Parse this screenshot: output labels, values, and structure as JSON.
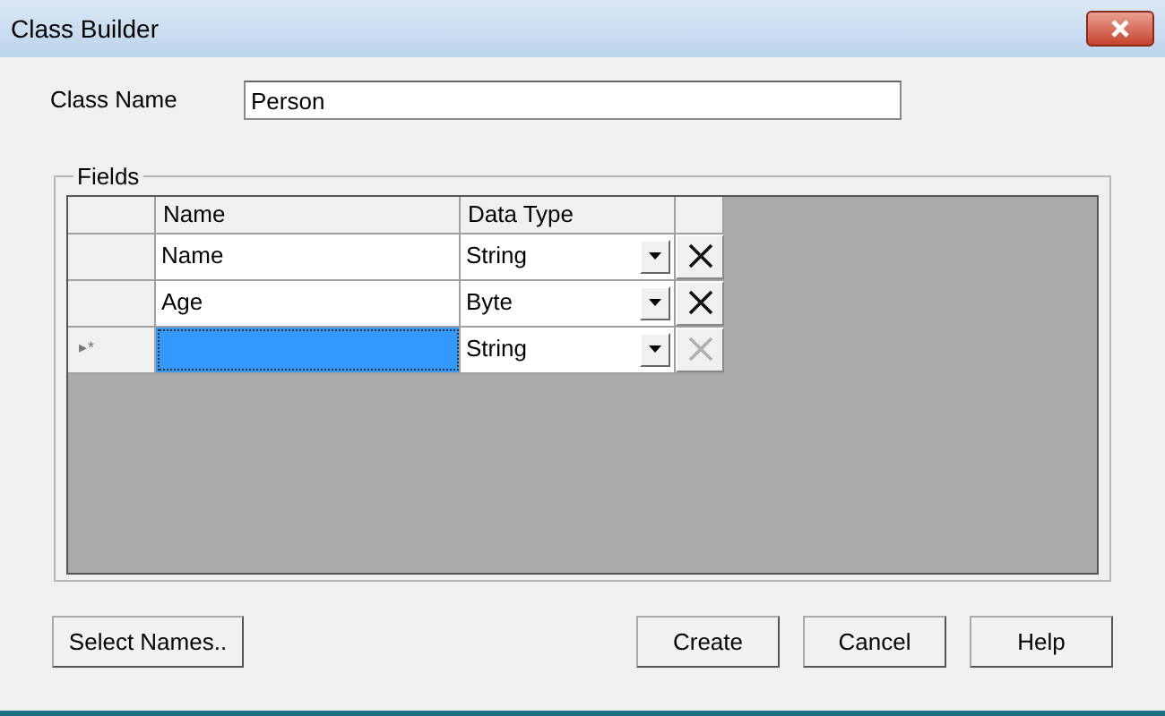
{
  "window": {
    "title": "Class Builder"
  },
  "class_name": {
    "label": "Class Name",
    "value": "Person"
  },
  "fields": {
    "legend": "Fields",
    "columns": [
      "Name",
      "Data Type"
    ],
    "rows": [
      {
        "indicator": "",
        "name": "Name",
        "data_type": "String",
        "selected": false,
        "delete_disabled": false
      },
      {
        "indicator": "",
        "name": "Age",
        "data_type": "Byte",
        "selected": false,
        "delete_disabled": false
      },
      {
        "indicator": "▸*",
        "name": "",
        "data_type": "String",
        "selected": true,
        "delete_disabled": true
      }
    ]
  },
  "buttons": [
    "Select Names..",
    "Create",
    "Cancel",
    "Help"
  ]
}
